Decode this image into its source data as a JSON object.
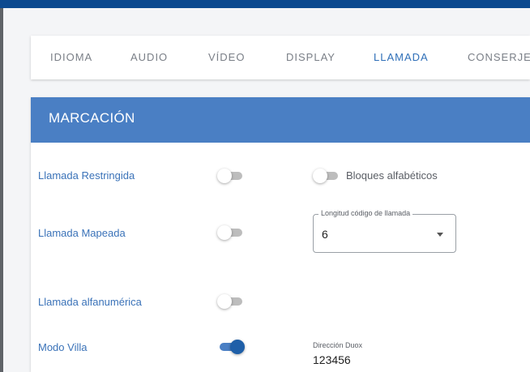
{
  "tabs": [
    {
      "label": "IDIOMA",
      "active": false
    },
    {
      "label": "AUDIO",
      "active": false
    },
    {
      "label": "VÍDEO",
      "active": false
    },
    {
      "label": "DISPLAY",
      "active": false
    },
    {
      "label": "LLAMADA",
      "active": true
    },
    {
      "label": "CONSERJE",
      "active": false
    }
  ],
  "section": {
    "title": "MARCACIÓN",
    "settings": [
      {
        "label": "Llamada Restringida",
        "enabled": false
      },
      {
        "label": "Llamada Mapeada",
        "enabled": false
      },
      {
        "label": "Llamada alfanumérica",
        "enabled": false
      },
      {
        "label": "Modo Villa",
        "enabled": true
      }
    ],
    "bloques": {
      "label": "Bloques alfabéticos",
      "enabled": false
    },
    "longitud": {
      "label": "Longitud código de llamada",
      "value": "6"
    },
    "duox": {
      "label": "Dirección Duox",
      "value": "123456"
    }
  },
  "colors": {
    "top_bar": "#0d4a8f",
    "header": "#4a7fc4",
    "active_tab": "#2f6fb8",
    "toggle_on": "#1f5fa8"
  },
  "icons": {
    "select_arrow": "caret-down-icon"
  }
}
